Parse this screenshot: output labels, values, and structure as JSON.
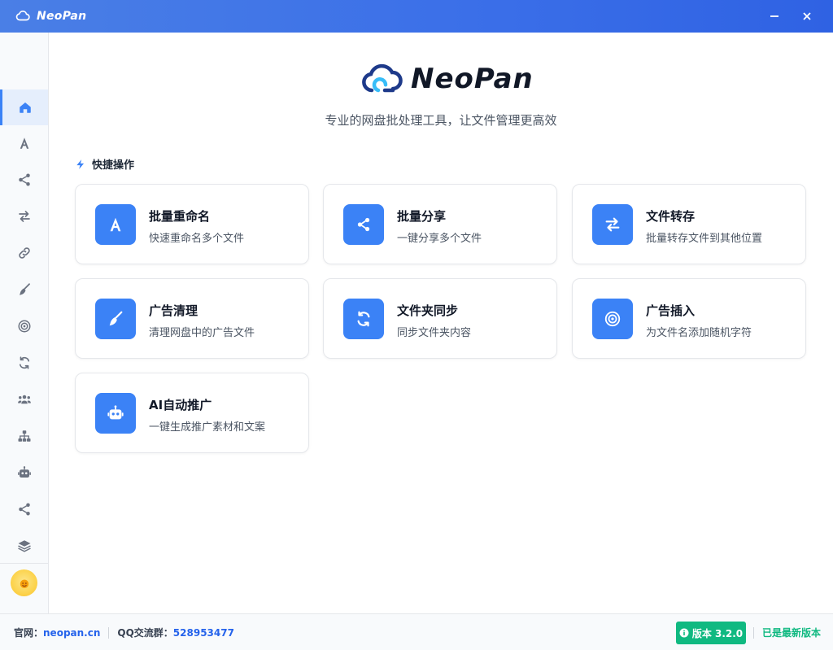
{
  "window": {
    "title": "NeoPan"
  },
  "sidebar": {
    "items": [
      {
        "icon": "home-icon"
      },
      {
        "icon": "font-icon"
      },
      {
        "icon": "share-icon"
      },
      {
        "icon": "transfer-icon"
      },
      {
        "icon": "link-icon"
      },
      {
        "icon": "broom-icon"
      },
      {
        "icon": "target-icon"
      },
      {
        "icon": "sync-icon"
      },
      {
        "icon": "users-icon"
      },
      {
        "icon": "sitemap-icon"
      },
      {
        "icon": "robot-icon"
      },
      {
        "icon": "share-alt-icon"
      },
      {
        "icon": "layers-icon"
      }
    ]
  },
  "brand": {
    "name": "NeoPan",
    "subtitle": "专业的网盘批处理工具，让文件管理更高效"
  },
  "quick": {
    "title": "快捷操作",
    "cards": [
      {
        "title": "批量重命名",
        "desc": "快速重命名多个文件",
        "icon": "font-icon"
      },
      {
        "title": "批量分享",
        "desc": "一键分享多个文件",
        "icon": "share-icon"
      },
      {
        "title": "文件转存",
        "desc": "批量转存文件到其他位置",
        "icon": "transfer-icon"
      },
      {
        "title": "广告清理",
        "desc": "清理网盘中的广告文件",
        "icon": "broom-icon"
      },
      {
        "title": "文件夹同步",
        "desc": "同步文件夹内容",
        "icon": "sync-icon"
      },
      {
        "title": "广告插入",
        "desc": "为文件名添加随机字符",
        "icon": "target-icon"
      },
      {
        "title": "AI自动推广",
        "desc": "一键生成推广素材和文案",
        "icon": "robot-icon"
      }
    ]
  },
  "footer": {
    "site_label": "官网：",
    "site_link": "neopan.cn",
    "qq_label": "QQ交流群：",
    "qq_number": "528953477",
    "version": "版本 3.2.0",
    "status": "已是最新版本"
  },
  "colors": {
    "accent": "#3b82f6",
    "success": "#10b981",
    "titlebar": "#3a6ee8"
  }
}
